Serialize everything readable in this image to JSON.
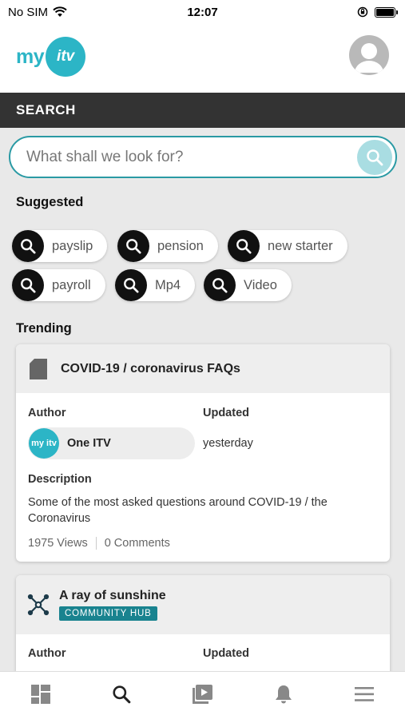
{
  "status_bar": {
    "carrier": "No SIM",
    "time": "12:07"
  },
  "header": {
    "logo_text": "my",
    "logo_mark": "itv"
  },
  "page_title": "SEARCH",
  "search": {
    "placeholder": "What shall we look for?"
  },
  "suggested": {
    "heading": "Suggested",
    "chips": [
      "payslip",
      "pension",
      "new starter",
      "payroll",
      "Mp4",
      "Video"
    ]
  },
  "trending": {
    "heading": "Trending",
    "cards": [
      {
        "title": "COVID-19 / coronavirus FAQs",
        "icon": "document-icon",
        "author_label": "Author",
        "updated_label": "Updated",
        "author": "One ITV",
        "author_avatar_text": "my itv",
        "updated": "yesterday",
        "description_label": "Description",
        "description": "Some of the most asked questions around COVID-19 / the Coronavirus",
        "views": "1975 Views",
        "comments": "0 Comments"
      },
      {
        "title": "A ray of sunshine",
        "icon": "network-icon",
        "badge": "COMMUNITY HUB",
        "author_label": "Author",
        "updated_label": "Updated"
      }
    ]
  },
  "tab_bar": {
    "items": [
      "dashboard-icon",
      "search-icon",
      "video-library-icon",
      "bell-icon",
      "menu-icon"
    ],
    "active": 1
  },
  "colors": {
    "accent": "#2cb5c6",
    "dark_bar": "#333333",
    "badge": "#19838f",
    "search_border": "#2a9aa4"
  }
}
